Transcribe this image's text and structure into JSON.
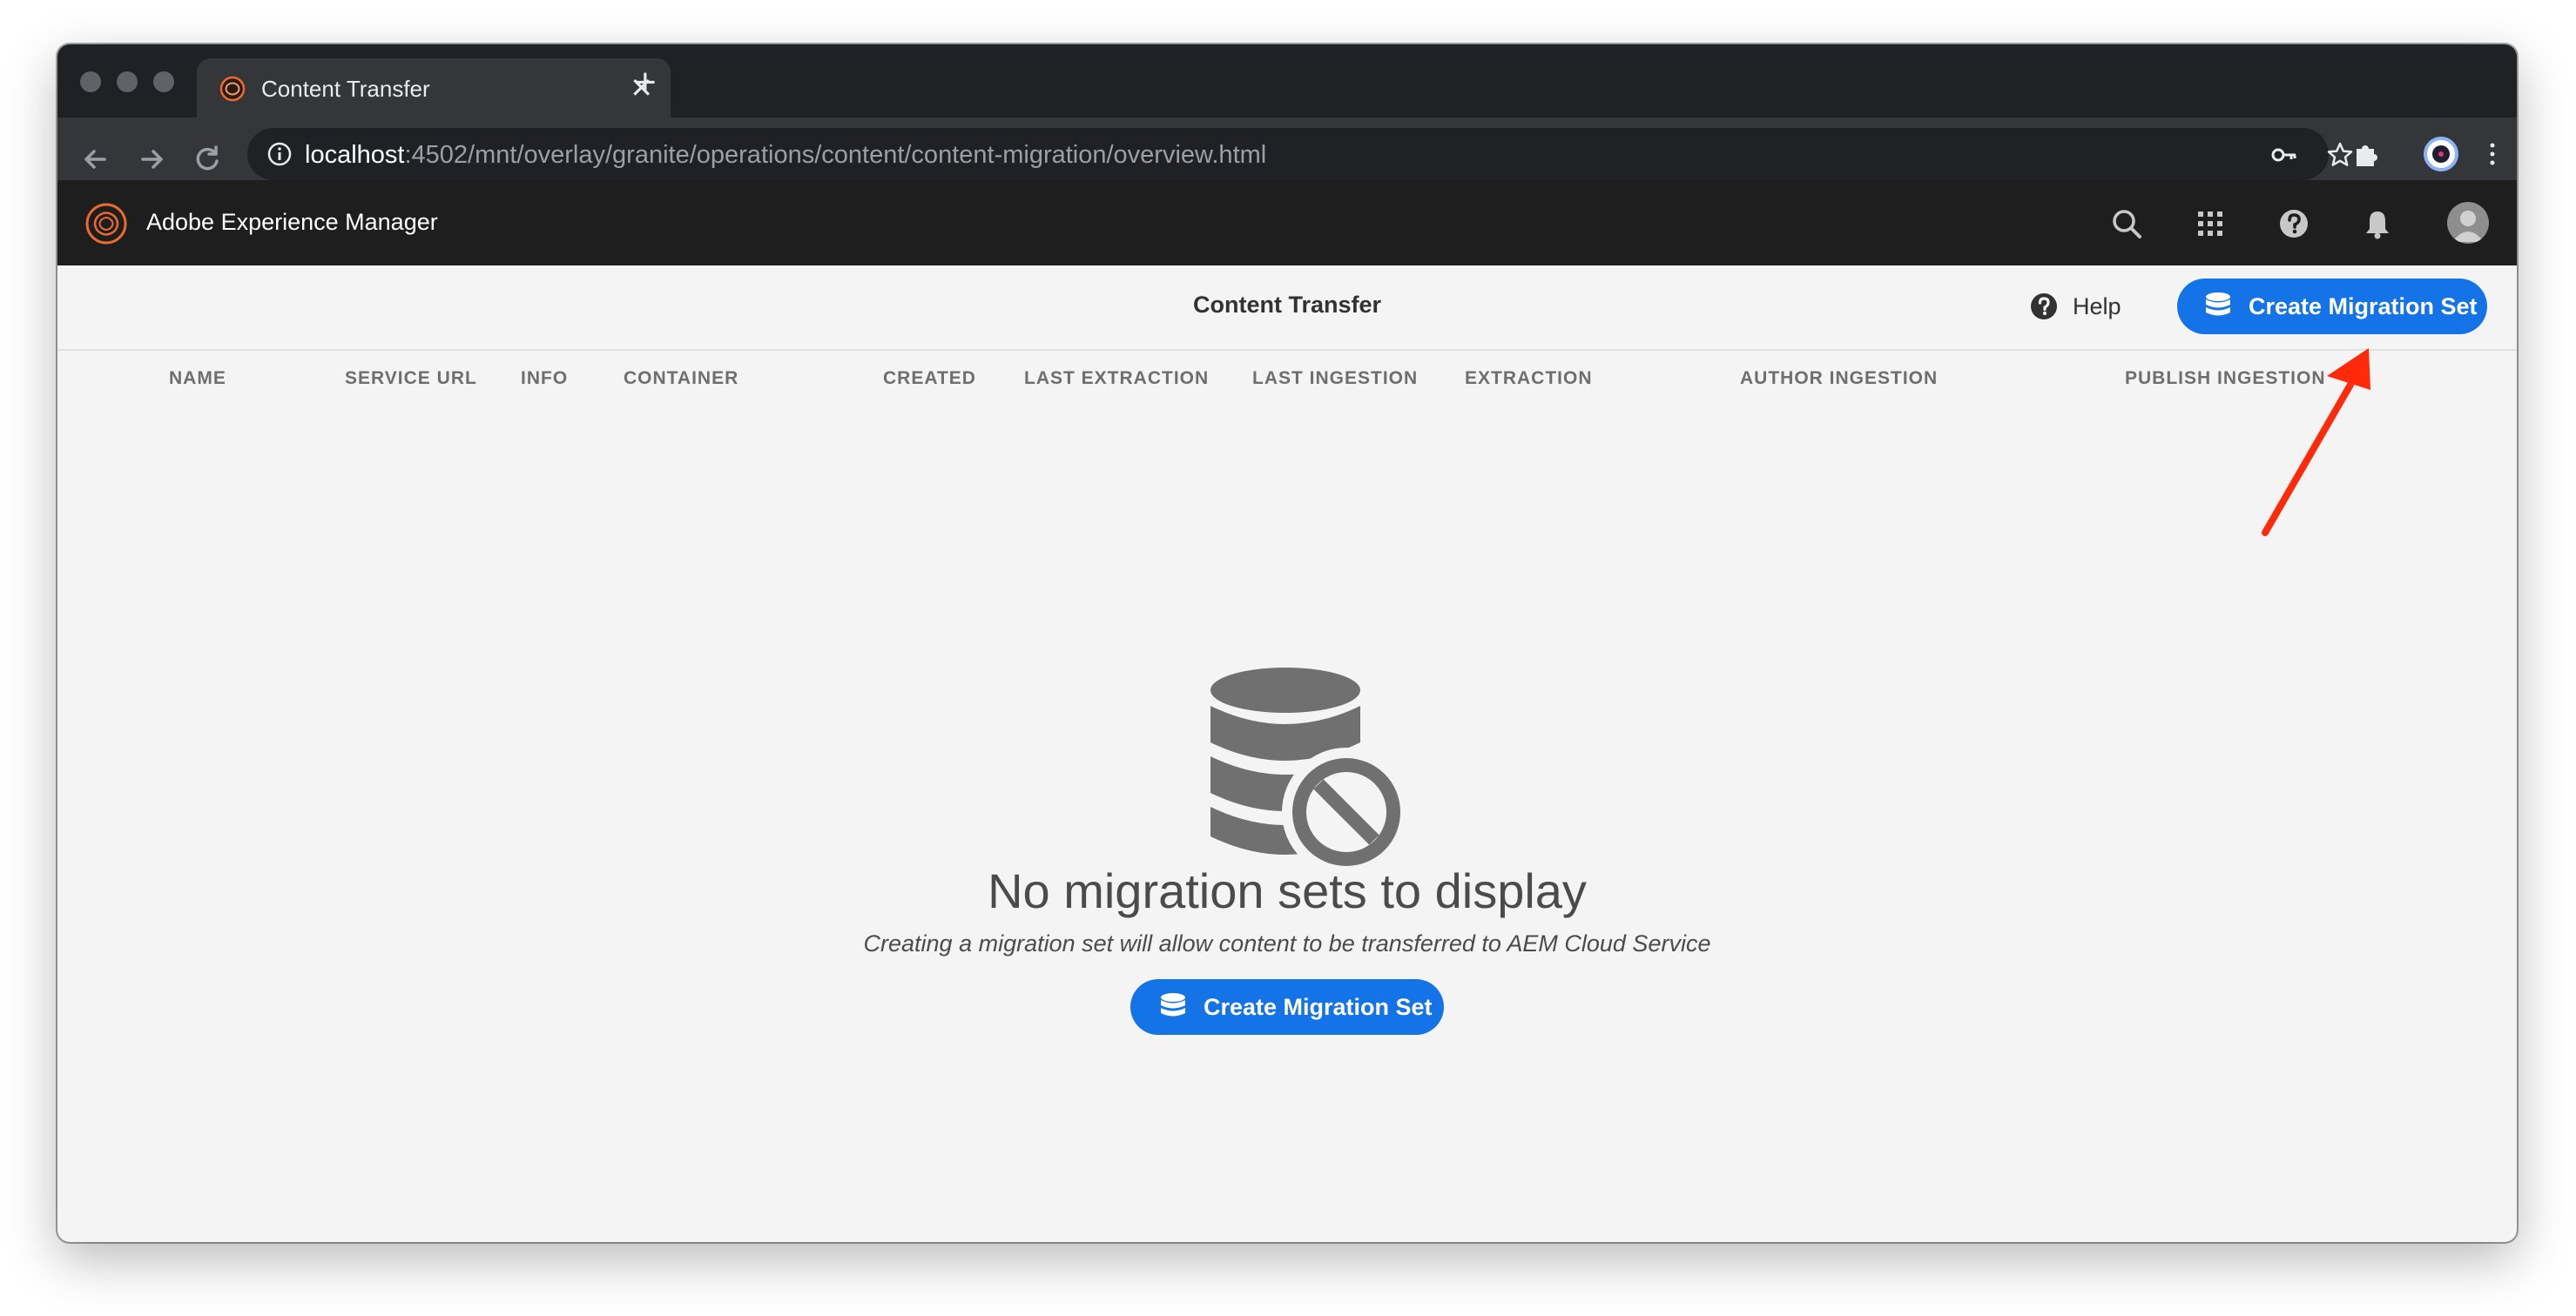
{
  "browser": {
    "tab_title": "Content Transfer",
    "new_tab": "+",
    "close": "✕",
    "url_host": "localhost",
    "url_path": ":4502/mnt/overlay/granite/operations/content/content-migration/overview.html"
  },
  "shell": {
    "app_title": "Adobe Experience Manager"
  },
  "actionbar": {
    "title": "Content Transfer",
    "help_label": "Help",
    "create_label": "Create Migration Set"
  },
  "table": {
    "columns": [
      "NAME",
      "SERVICE URL",
      "INFO",
      "CONTAINER",
      "CREATED",
      "LAST EXTRACTION",
      "LAST INGESTION",
      "EXTRACTION",
      "AUTHOR INGESTION",
      "PUBLISH INGESTION"
    ]
  },
  "empty_state": {
    "title": "No migration sets to display",
    "description": "Creating a migration set will allow content to be transferred to AEM Cloud Service",
    "button_label": "Create Migration Set"
  },
  "colors": {
    "primary": "#1473e6",
    "shell": "#1e1e1e",
    "annotation_arrow": "#ff2a0a",
    "aem_orange": "#eb6b2e"
  }
}
